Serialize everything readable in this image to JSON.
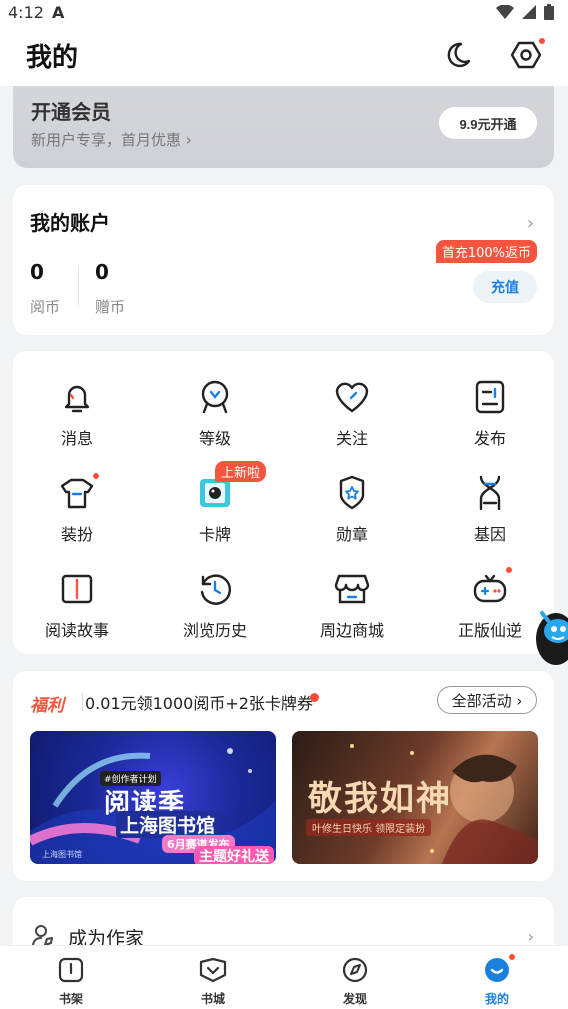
{
  "status_bar": {
    "time": "4:12",
    "a_icon": "A"
  },
  "header": {
    "title": "我的",
    "moon_icon": "moon-icon",
    "settings_icon": "settings-icon"
  },
  "vip": {
    "title": "开通会员",
    "subtitle": "新用户专享，首月优惠 ›",
    "button_label": "9.9元开通"
  },
  "account": {
    "title": "我的账户",
    "chevron": "›",
    "balances": [
      {
        "value": "0",
        "label": "阅币"
      },
      {
        "value": "0",
        "label": "赠币"
      }
    ],
    "promo_tag": "首充100%返币",
    "recharge_label": "充值"
  },
  "features": [
    {
      "label": "消息",
      "icon": "bell-icon"
    },
    {
      "label": "等级",
      "icon": "level-badge-icon"
    },
    {
      "label": "关注",
      "icon": "heart-icon"
    },
    {
      "label": "发布",
      "icon": "document-icon"
    },
    {
      "label": "装扮",
      "icon": "shirt-icon"
    },
    {
      "label": "卡牌",
      "icon": "card-icon",
      "badge": "上新啦"
    },
    {
      "label": "勋章",
      "icon": "medal-icon"
    },
    {
      "label": "基因",
      "icon": "dna-icon"
    },
    {
      "label": "阅读故事",
      "icon": "book-icon"
    },
    {
      "label": "浏览历史",
      "icon": "clock-icon"
    },
    {
      "label": "周边商城",
      "icon": "shop-icon"
    },
    {
      "label": "正版仙逆",
      "icon": "gamepad-icon"
    }
  ],
  "welfare": {
    "tag": "福利",
    "text": "0.01元领1000阅币+2张卡牌券",
    "all_label": "全部活动 ›",
    "banner1": {
      "small": "#创作者计划",
      "title": "阅读季",
      "subtitle": "上海图书馆",
      "pill1": "6月赛道发布",
      "pill2": "主题好礼送",
      "logo": "上海图书馆"
    },
    "banner2": {
      "title": "敬我如神",
      "subtitle": "叶修生日快乐 领限定装扮"
    }
  },
  "author": {
    "label": "成为作家",
    "chevron": "›"
  },
  "bottom_nav": [
    {
      "label": "书架",
      "icon": "bookshelf-icon"
    },
    {
      "label": "书城",
      "icon": "bookstore-icon"
    },
    {
      "label": "发现",
      "icon": "compass-icon"
    },
    {
      "label": "我的",
      "icon": "profile-icon"
    }
  ],
  "colors": {
    "accent": "#1b7fe0",
    "red": "#f5553e"
  }
}
